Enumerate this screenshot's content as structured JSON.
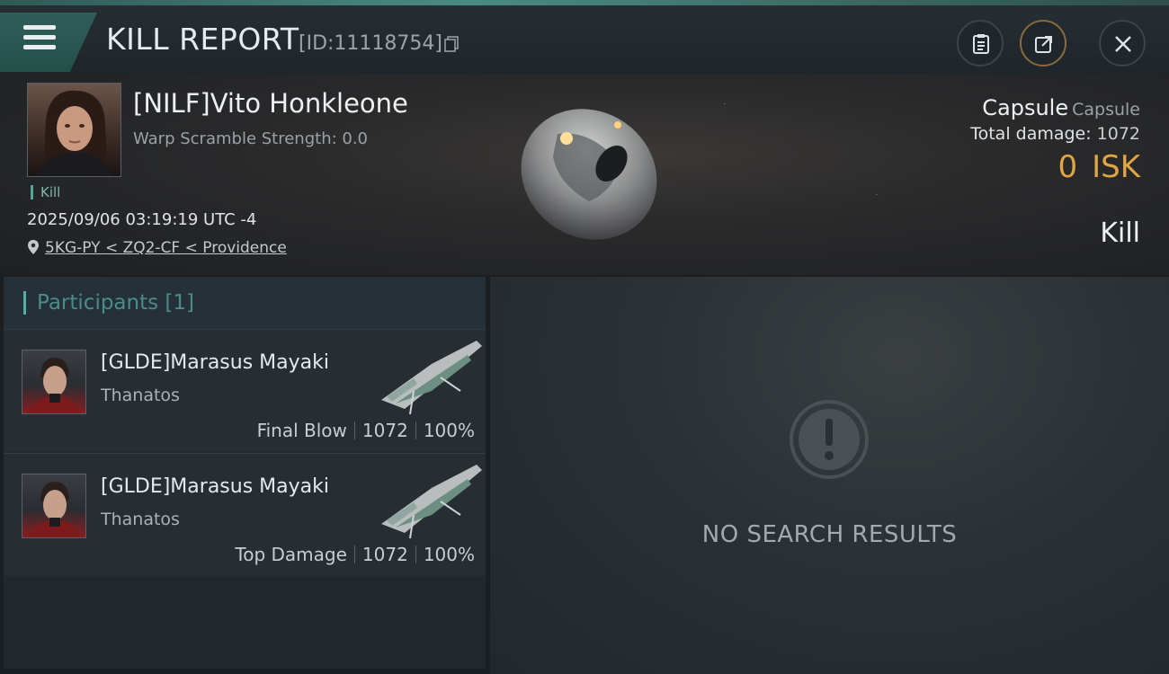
{
  "header": {
    "title": "KILL REPORT",
    "report_id": "[ID:11118754]"
  },
  "victim": {
    "name": "[NILF]Vito Honkleone",
    "warp_scramble": "Warp Scramble Strength: 0.0",
    "tag": "Kill",
    "datetime": "2025/09/06 03:19:19 UTC -4",
    "location": "5KG-PY < ZQ2-CF < Providence",
    "ship_name": "Capsule",
    "ship_class": "Capsule",
    "total_damage_label": "Total damage:",
    "total_damage": "1072",
    "isk_value": "0",
    "isk_label": "ISK",
    "result": "Kill"
  },
  "participants": {
    "title": "Participants [1]",
    "items": [
      {
        "name": "[GLDE]Marasus Mayaki",
        "ship": "Thanatos",
        "role": "Final Blow",
        "damage": "1072",
        "percent": "100%"
      },
      {
        "name": "[GLDE]Marasus Mayaki",
        "ship": "Thanatos",
        "role": "Top Damage",
        "damage": "1072",
        "percent": "100%"
      }
    ]
  },
  "results_panel": {
    "empty_text": "NO SEARCH RESULTS"
  },
  "colors": {
    "accent": "#4fb0a6",
    "isk": "#e1a544"
  }
}
